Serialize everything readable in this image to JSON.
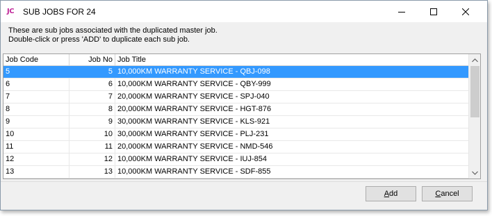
{
  "window": {
    "logo": "JC",
    "title": "SUB JOBS FOR 24"
  },
  "info": {
    "line1": "These are sub jobs associated with the duplicated master job.",
    "line2": "Double-click or press 'ADD' to duplicate each sub job."
  },
  "grid": {
    "columns": [
      "Job Code",
      "Job No",
      "Job Title"
    ],
    "rows": [
      {
        "code": "5",
        "no": "5",
        "title": "10,000KM WARRANTY SERVICE - QBJ-098",
        "selected": true
      },
      {
        "code": "6",
        "no": "6",
        "title": "10,000KM WARRANTY SERVICE - QBY-999"
      },
      {
        "code": "7",
        "no": "7",
        "title": "20,000KM WARRANTY SERVICE -  SPJ-040"
      },
      {
        "code": "8",
        "no": "8",
        "title": "20,000KM WARRANTY SERVICE - HGT-876"
      },
      {
        "code": "9",
        "no": "9",
        "title": "30,000KM WARRANTY SERVICE - KLS-921"
      },
      {
        "code": "10",
        "no": "10",
        "title": "30,000KM WARRANTY SERVICE - PLJ-231"
      },
      {
        "code": "11",
        "no": "11",
        "title": "20,000KM WARRANTY SERVICE - NMD-546"
      },
      {
        "code": "12",
        "no": "12",
        "title": "10,000KM WARRANTY SERVICE - IUJ-854"
      },
      {
        "code": "13",
        "no": "13",
        "title": "10,000KM WARRANTY SERVICE - SDF-855"
      }
    ]
  },
  "buttons": {
    "add_accel": "A",
    "add_rest": "dd",
    "cancel_accel": "C",
    "cancel_rest": "ancel"
  },
  "icons": {
    "minimize": "minimize-icon",
    "maximize": "maximize-icon",
    "close": "close-icon",
    "scroll_up": "chevron-up-icon",
    "scroll_down": "chevron-down-icon"
  },
  "colors": {
    "logo": "#c0289a",
    "selection": "#3399ff",
    "window_bg": "#f0f0f0"
  }
}
